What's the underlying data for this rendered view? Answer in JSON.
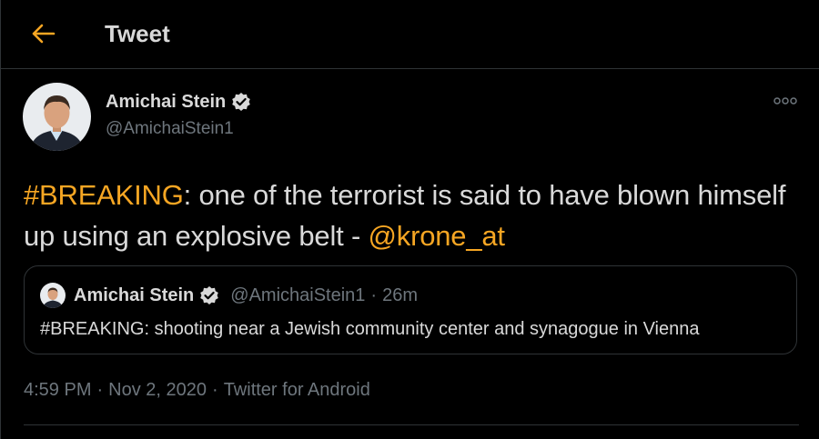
{
  "header": {
    "title": "Tweet",
    "back_icon": "arrow-left-icon"
  },
  "colors": {
    "accent": "#f6a623",
    "background": "#000000",
    "text": "#d9d9d9",
    "secondary_text": "#6e767d",
    "border": "#2f3336"
  },
  "tweet": {
    "author_name": "Amichai Stein",
    "author_handle": "@AmichaiStein1",
    "verified_icon": "verified-badge-icon",
    "more_icon": "more-options-icon",
    "text_parts": {
      "hashtag": "#BREAKING",
      "body": ": one of the terrorist is said to have blown himself up using an explosive belt - ",
      "mention": "@krone_at"
    },
    "quoted": {
      "author_name": "Amichai Stein",
      "author_handle": "@AmichaiStein1",
      "separator": "·",
      "time": "26m",
      "text": "#BREAKING: shooting near a Jewish community center and synagogue in Vienna"
    },
    "meta": {
      "time": "4:59 PM",
      "separator_1": "·",
      "date": "Nov 2, 2020",
      "separator_2": "·",
      "source": "Twitter for Android"
    }
  }
}
